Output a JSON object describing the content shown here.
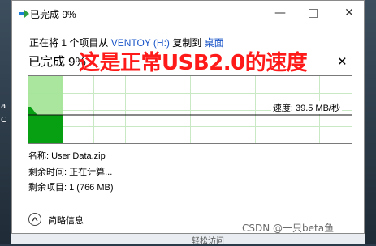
{
  "window": {
    "title": "已完成 9%",
    "min_glyph": "—",
    "close_glyph": "✕"
  },
  "copy_line": {
    "prefix": "正在将 1 个项目从 ",
    "source": "VENTOY (H:)",
    "middle": " 复制到 ",
    "destination": "桌面"
  },
  "progress": {
    "heading": "已完成 9%",
    "percent": 9,
    "close_glyph": "✕"
  },
  "overlay_caption": "这是正常USB2.0的速度",
  "graph": {
    "speed_label": "速度: 39.5 MB/秒",
    "fill_color": "#06a012",
    "progress_color": "#a6e59a",
    "grid_color": "#c9e8c4"
  },
  "info": {
    "name": "名称: User Data.zip",
    "time_remaining": "剩余时间: 正在计算...",
    "items_remaining": "剩余项目: 1 (766 MB)"
  },
  "details_toggle": {
    "label": "简略信息",
    "icon": "chevron-up-icon"
  },
  "watermark": "CSDN @一只beta鱼",
  "background": {
    "left_text_a": "a",
    "left_text_b": "C",
    "bottom_text": "轻松访问"
  }
}
